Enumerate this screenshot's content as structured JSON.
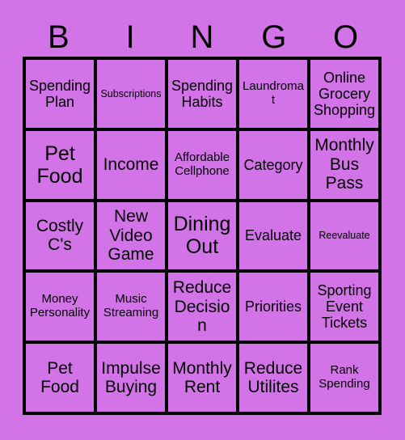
{
  "card": {
    "title": "BINGO",
    "background_color": "#d274e8",
    "border_color": "#000000",
    "text_color": "#000000",
    "header_letters": [
      "B",
      "I",
      "N",
      "G",
      "O"
    ],
    "grid_size": "5x5",
    "rows": [
      [
        {
          "label": "Spending Plan",
          "size": "md"
        },
        {
          "label": "Subscriptions",
          "size": "xs"
        },
        {
          "label": "Spending Habits",
          "size": "md"
        },
        {
          "label": "Laundromat",
          "size": "sm"
        },
        {
          "label": "Online Grocery Shopping",
          "size": "md"
        }
      ],
      [
        {
          "label": "Pet Food",
          "size": "xl"
        },
        {
          "label": "Income",
          "size": "lg"
        },
        {
          "label": "Affordable Cellphone",
          "size": "sm"
        },
        {
          "label": "Category",
          "size": "md"
        },
        {
          "label": "Monthly Bus Pass",
          "size": "lg"
        }
      ],
      [
        {
          "label": "Costly C's",
          "size": "lg"
        },
        {
          "label": "New Video Game",
          "size": "lg"
        },
        {
          "label": "Dining Out",
          "size": "xl"
        },
        {
          "label": "Evaluate",
          "size": "md"
        },
        {
          "label": "Reevaluate",
          "size": "xs"
        }
      ],
      [
        {
          "label": "Money Personality",
          "size": "sm"
        },
        {
          "label": "Music Streaming",
          "size": "sm"
        },
        {
          "label": "Reduce Decision",
          "size": "lg"
        },
        {
          "label": "Priorities",
          "size": "md"
        },
        {
          "label": "Sporting Event Tickets",
          "size": "md"
        }
      ],
      [
        {
          "label": "Pet Food",
          "size": "lg"
        },
        {
          "label": "Impulse Buying",
          "size": "lg"
        },
        {
          "label": "Monthly Rent",
          "size": "lg"
        },
        {
          "label": "Reduce Utilites",
          "size": "lg"
        },
        {
          "label": "Rank Spending",
          "size": "sm"
        }
      ]
    ]
  }
}
